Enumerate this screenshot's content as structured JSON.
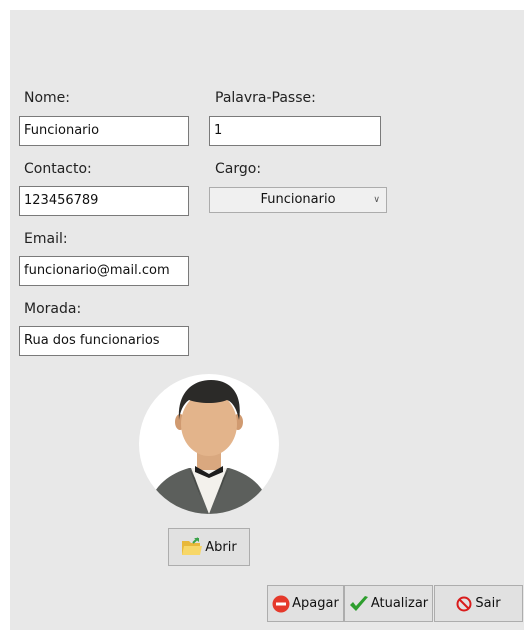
{
  "form": {
    "name_label": "Nome:",
    "name_value": "Funcionario",
    "password_label": "Palavra-Passe:",
    "password_value": "1",
    "contact_label": "Contacto:",
    "contact_value": "123456789",
    "role_label": "Cargo:",
    "role_value": "Funcionario",
    "email_label": "Email:",
    "email_value": "funcionario@mail.com",
    "address_label": "Morada:",
    "address_value": "Rua dos funcionarios"
  },
  "photo": {
    "icon": "employee-avatar",
    "open_label": "Abrir",
    "open_icon": "folder-open-icon"
  },
  "actions": {
    "delete_label": "Apagar",
    "delete_icon": "minus-circle-icon",
    "update_label": "Atualizar",
    "update_icon": "checkmark-icon",
    "exit_label": "Sair",
    "exit_icon": "no-entry-icon"
  },
  "colors": {
    "background": "#e8e8e8",
    "delete_red": "#e5392b",
    "update_green": "#2e9e2e",
    "exit_red": "#d91c1c"
  }
}
